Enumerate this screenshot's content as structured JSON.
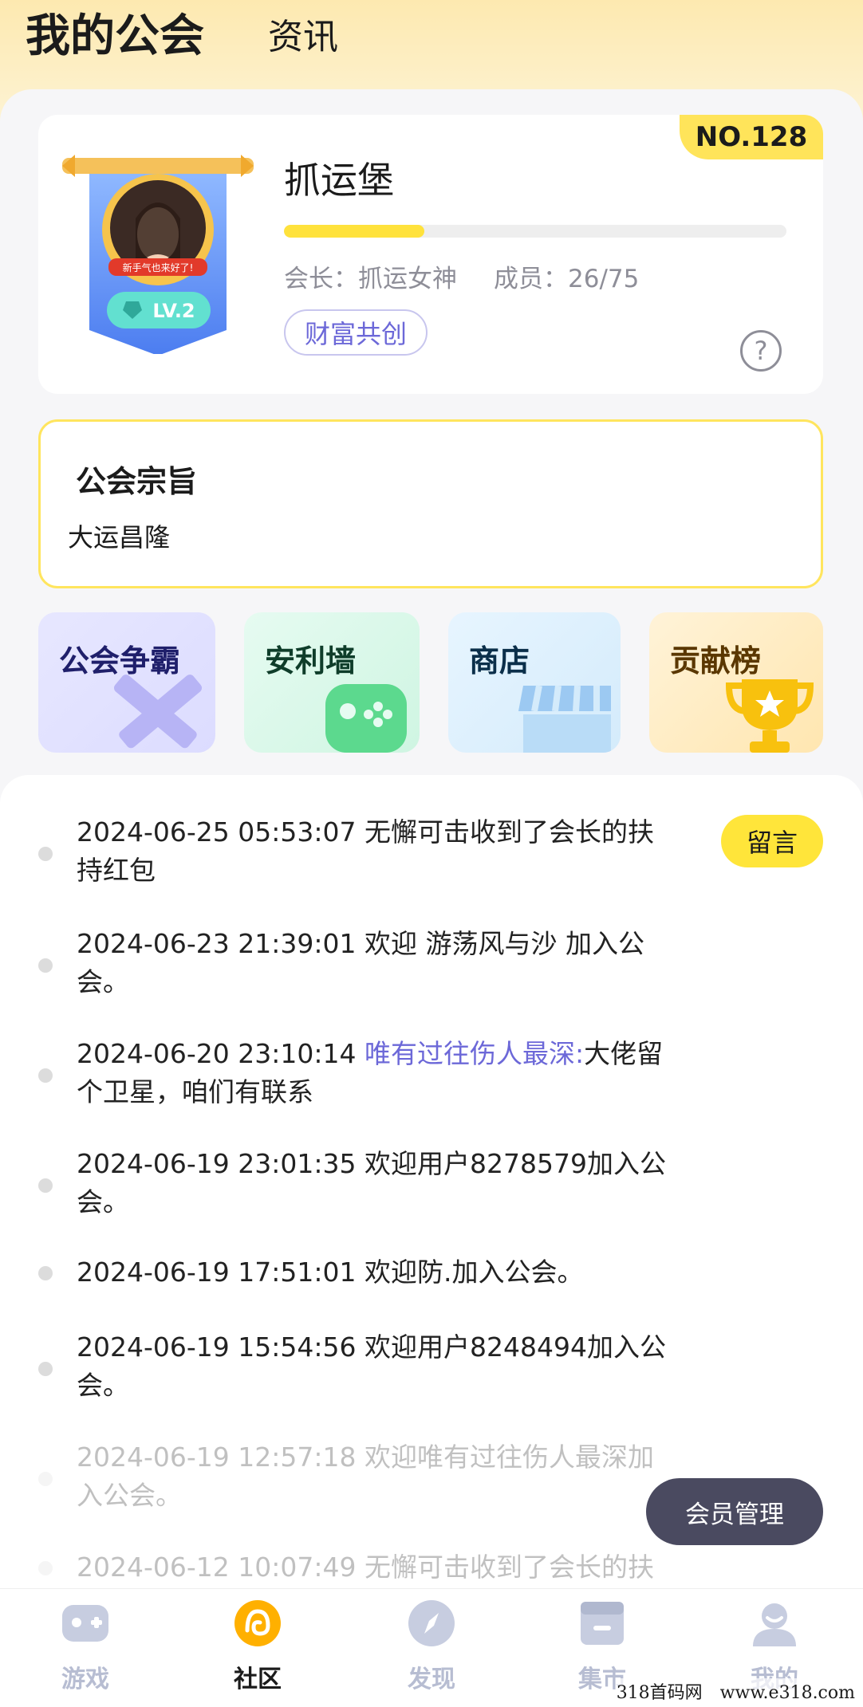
{
  "header": {
    "tab_active": "我的公会",
    "tab_other": "资讯"
  },
  "guild": {
    "rank": "NO.128",
    "name": "抓运堡",
    "banner_caption": "新手气也来好了!",
    "level": "LV.2",
    "progress": 0.28,
    "leader": "会长：抓运女神",
    "members": "成员：26/75",
    "tag": "财富共创",
    "help_symbol": "?"
  },
  "purpose": {
    "title": "公会宗旨",
    "text": "大运昌隆"
  },
  "features": [
    {
      "label": "公会争霸",
      "icon": "crossed-swords-icon"
    },
    {
      "label": "安利墙",
      "icon": "gamepad-icon"
    },
    {
      "label": "商店",
      "icon": "store-awning-icon"
    },
    {
      "label": "贡献榜",
      "icon": "trophy-icon"
    }
  ],
  "feed": {
    "message_button": "留言",
    "items": [
      {
        "time": "2024-06-25 05:53:07",
        "text": "无懈可击收到了会长的扶持红包",
        "highlight": ""
      },
      {
        "time": "2024-06-23 21:39:01",
        "text": "欢迎 游荡风与沙 加入公会。",
        "highlight": ""
      },
      {
        "time": "2024-06-20 23:10:14",
        "highlight": "唯有过往伤人最深:",
        "text": "大佬留个卫星，咱们有联系"
      },
      {
        "time": "2024-06-19 23:01:35",
        "text": "欢迎用户8278579加入公会。",
        "highlight": ""
      },
      {
        "time": "2024-06-19 17:51:01",
        "text": "欢迎防.加入公会。",
        "highlight": ""
      },
      {
        "time": "2024-06-19 15:54:56",
        "text": "欢迎用户8248494加入公会。",
        "highlight": ""
      },
      {
        "time": "2024-06-19 12:57:18",
        "text": "欢迎唯有过往伤人最深加入公会。",
        "highlight": ""
      },
      {
        "time": "2024-06-12 10:07:49",
        "text": "无懈可击收到了会长的扶",
        "highlight": ""
      }
    ]
  },
  "member_manage_button": "会员管理",
  "nav": {
    "items": [
      {
        "label": "游戏",
        "icon": "gamepad-icon"
      },
      {
        "label": "社区",
        "icon": "community-icon"
      },
      {
        "label": "发现",
        "icon": "compass-icon"
      },
      {
        "label": "集市",
        "icon": "market-icon"
      },
      {
        "label": "我的",
        "icon": "profile-icon"
      }
    ],
    "active": "社区"
  },
  "watermark": "318首码网　www.e318.com",
  "colors": {
    "accent_yellow": "#ffe23c",
    "accent_purple": "#6c68d8",
    "nav_inactive": "#b7bdd2"
  }
}
